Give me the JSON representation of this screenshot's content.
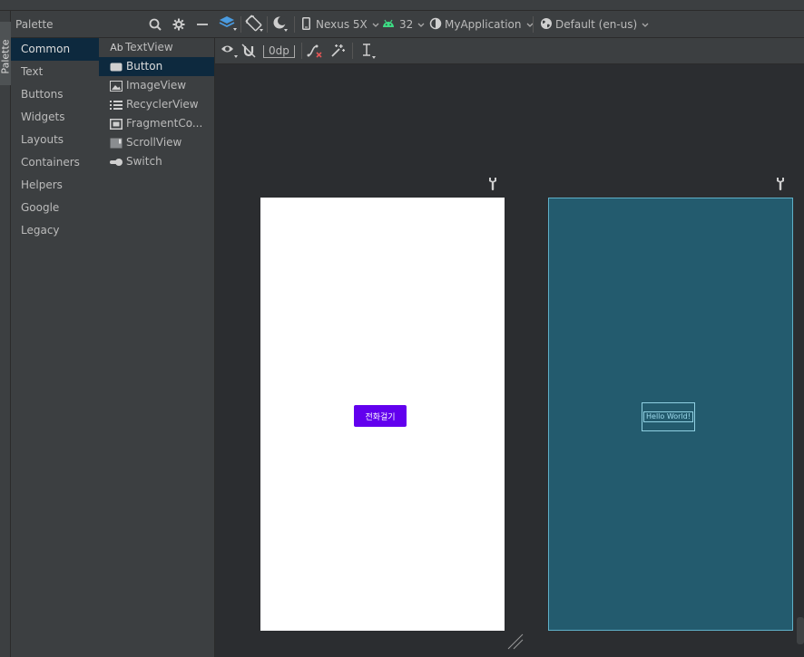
{
  "palette": {
    "title": "Palette",
    "side_tab_label": "Palette",
    "categories": [
      {
        "label": "Common",
        "selected": true
      },
      {
        "label": "Text"
      },
      {
        "label": "Buttons"
      },
      {
        "label": "Widgets"
      },
      {
        "label": "Layouts"
      },
      {
        "label": "Containers"
      },
      {
        "label": "Helpers"
      },
      {
        "label": "Google"
      },
      {
        "label": "Legacy"
      }
    ],
    "components": [
      {
        "label": "TextView",
        "icon": "textview-icon",
        "icon_text": "Ab"
      },
      {
        "label": "Button",
        "icon": "button-icon",
        "selected": true
      },
      {
        "label": "ImageView",
        "icon": "image-icon"
      },
      {
        "label": "RecyclerView",
        "icon": "list-icon"
      },
      {
        "label": "FragmentCo...",
        "icon": "fragment-icon"
      },
      {
        "label": "ScrollView",
        "icon": "scrollview-icon"
      },
      {
        "label": "Switch",
        "icon": "switch-icon"
      }
    ]
  },
  "toolbar": {
    "device": "Nexus 5X",
    "api": "32",
    "theme": "MyApplication",
    "locale": "Default (en-us)",
    "margin": "0dp"
  },
  "design": {
    "button_text": "전화걸기",
    "blueprint_text": "Hello World!",
    "button_color": "#6200ee",
    "blueprint_bg": "#235b6e"
  },
  "colors": {
    "panel": "#3c3f41",
    "canvas": "#2b2d30",
    "selection": "#0d293e",
    "android_green": "#3ddc84"
  }
}
